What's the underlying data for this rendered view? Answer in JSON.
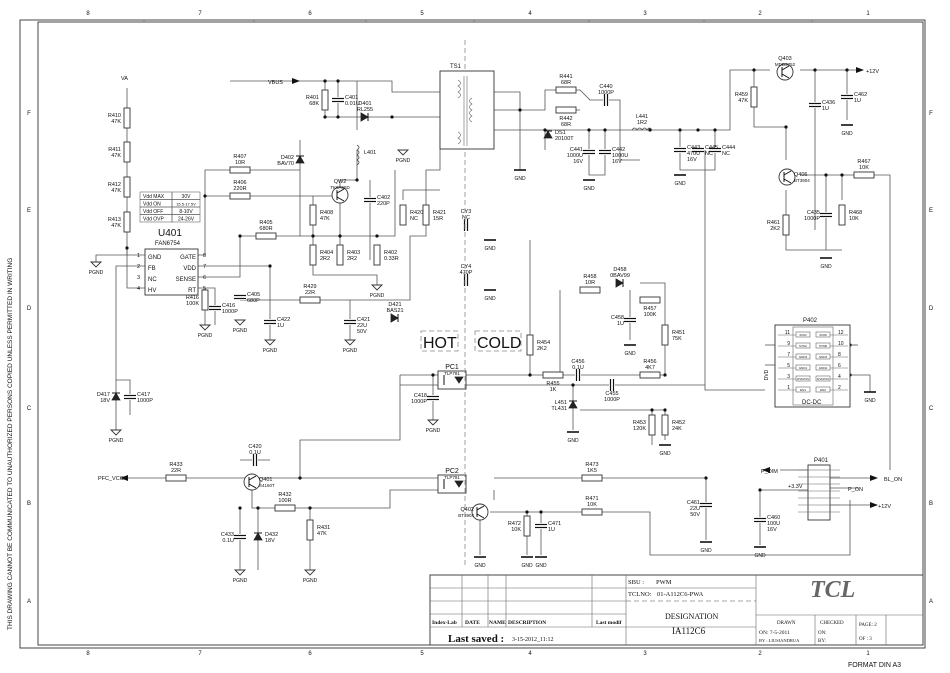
{
  "frame": {
    "columns": [
      "8",
      "7",
      "6",
      "5",
      "4",
      "3",
      "2",
      "1"
    ],
    "rows": [
      "F",
      "E",
      "D",
      "C",
      "B",
      "A"
    ],
    "side_note": "THIS DRAWING CANNOT BE COMMUNICATED TO UNAUTHORIZED PERSONS COPIED UNLESS PERMITTED IN WRITING",
    "format": "FORMAT DIN A3"
  },
  "regions": {
    "hot": "HOT",
    "cold": "COLD"
  },
  "nets": {
    "va": "VA",
    "vbus": "VBUS",
    "v12_top": "+12V",
    "pfc_vcc": "PFC_VCC",
    "p_dim": "P_DIM",
    "bl_on": "BL_ON",
    "p_on": "P_ON",
    "v33": "+3.3V",
    "v12_bottom": "+12V",
    "gnd": "GND",
    "pgnd": "PGND",
    "dvd": "DVD"
  },
  "vdd_table": [
    [
      "Vdd MAX",
      "30V"
    ],
    [
      "Vdd ON",
      "15.5-17.5V"
    ],
    [
      "Vdd OFF",
      "8-10V"
    ],
    [
      "Vdd OVP",
      "24-26V"
    ]
  ],
  "u401": {
    "ref": "U401",
    "part": "FAN6754",
    "pins_left": [
      [
        "1",
        "GND"
      ],
      [
        "2",
        "FB"
      ],
      [
        "3",
        "NC"
      ],
      [
        "4",
        "HV"
      ]
    ],
    "pins_right": [
      [
        "8",
        "GATE"
      ],
      [
        "7",
        "VDD"
      ],
      [
        "6",
        "SENSE"
      ],
      [
        "5",
        "RT"
      ]
    ]
  },
  "ts1": {
    "ref": "TS1"
  },
  "p402": {
    "ref": "P402",
    "footer": "DC-DC",
    "pins": [
      [
        "11",
        "3V3C",
        "3V3D",
        "12"
      ],
      [
        "9",
        "5VSA",
        "5VSB",
        "10"
      ],
      [
        "7",
        "GND3",
        "GND4",
        "8"
      ],
      [
        "5",
        "GND1",
        "GND2",
        "6"
      ],
      [
        "3",
        "DVD/ON",
        "DVD/ON",
        "4"
      ],
      [
        "1",
        "EN1",
        "EN2",
        "2"
      ]
    ]
  },
  "p401": {
    "ref": "P401"
  },
  "components": [
    {
      "ref": "R410",
      "value": "47K"
    },
    {
      "ref": "R411",
      "value": "47K"
    },
    {
      "ref": "R412",
      "value": "47K"
    },
    {
      "ref": "R413",
      "value": "47K"
    },
    {
      "ref": "R401",
      "value": "68K"
    },
    {
      "ref": "C401",
      "value": "0.01U"
    },
    {
      "ref": "D401",
      "value": "RL255"
    },
    {
      "ref": "R407",
      "value": "10R"
    },
    {
      "ref": "R406",
      "value": "220R"
    },
    {
      "ref": "D402",
      "value": "BAV70"
    },
    {
      "ref": "QW2",
      "value": "TK6A65D"
    },
    {
      "ref": "L401",
      "value": ""
    },
    {
      "ref": "C402",
      "value": "220P"
    },
    {
      "ref": "R408",
      "value": "47K"
    },
    {
      "ref": "R405",
      "value": "680R"
    },
    {
      "ref": "R404",
      "value": "2R2"
    },
    {
      "ref": "R403",
      "value": "2R2"
    },
    {
      "ref": "R402",
      "value": "0.33R"
    },
    {
      "ref": "C405",
      "value": "680P"
    },
    {
      "ref": "R416",
      "value": "100K"
    },
    {
      "ref": "C416",
      "value": "1000P"
    },
    {
      "ref": "C422",
      "value": "1U"
    },
    {
      "ref": "R429",
      "value": "22R"
    },
    {
      "ref": "C421",
      "value": "22U 50V"
    },
    {
      "ref": "D421",
      "value": "BAS21"
    },
    {
      "ref": "R420",
      "value": "NC"
    },
    {
      "ref": "R421",
      "value": "15R"
    },
    {
      "ref": "CY3",
      "value": "NC"
    },
    {
      "ref": "CY4",
      "value": "470P"
    },
    {
      "ref": "R441",
      "value": "68R"
    },
    {
      "ref": "R442",
      "value": "68R"
    },
    {
      "ref": "C440",
      "value": "1000P"
    },
    {
      "ref": "DS1",
      "value": "20100T"
    },
    {
      "ref": "C441",
      "value": "1000U 16V"
    },
    {
      "ref": "C442",
      "value": "1000U 16V"
    },
    {
      "ref": "L441",
      "value": "1R2"
    },
    {
      "ref": "C443",
      "value": "470U 16V"
    },
    {
      "ref": "C445",
      "value": "NC"
    },
    {
      "ref": "C444",
      "value": "NC"
    },
    {
      "ref": "Q403",
      "value": "MDD3752"
    },
    {
      "ref": "R459",
      "value": "47K"
    },
    {
      "ref": "C436",
      "value": "1U"
    },
    {
      "ref": "C462",
      "value": "1U"
    },
    {
      "ref": "Q406",
      "value": "BT3904"
    },
    {
      "ref": "R467",
      "value": "10K"
    },
    {
      "ref": "C435",
      "value": "1000P"
    },
    {
      "ref": "R468",
      "value": "10K"
    },
    {
      "ref": "R461",
      "value": "2K2"
    },
    {
      "ref": "R454",
      "value": "2K2"
    },
    {
      "ref": "R458",
      "value": "10R"
    },
    {
      "ref": "D458",
      "value": "0BAV99"
    },
    {
      "ref": "R457",
      "value": "100K"
    },
    {
      "ref": "C458",
      "value": "1U"
    },
    {
      "ref": "R451",
      "value": "75K"
    },
    {
      "ref": "PC1",
      "value": "TLP781"
    },
    {
      "ref": "C418",
      "value": "1000P"
    },
    {
      "ref": "R455",
      "value": "1K"
    },
    {
      "ref": "C456",
      "value": "0.1U"
    },
    {
      "ref": "R456",
      "value": "4K7"
    },
    {
      "ref": "C455",
      "value": "1000P"
    },
    {
      "ref": "L451",
      "value": "TL431"
    },
    {
      "ref": "R453",
      "value": "120K"
    },
    {
      "ref": "R452",
      "value": "24K"
    },
    {
      "ref": "D417",
      "value": "18V"
    },
    {
      "ref": "C417",
      "value": "1000P"
    },
    {
      "ref": "R433",
      "value": "22R"
    },
    {
      "ref": "C420",
      "value": "0.1U"
    },
    {
      "ref": "Q401",
      "value": "S4160T"
    },
    {
      "ref": "R432",
      "value": "100R"
    },
    {
      "ref": "C433",
      "value": "0.1U"
    },
    {
      "ref": "D432",
      "value": "18V"
    },
    {
      "ref": "R431",
      "value": "47K"
    },
    {
      "ref": "PC2",
      "value": "TLP781"
    },
    {
      "ref": "R473",
      "value": "1K5"
    },
    {
      "ref": "C461",
      "value": "22U 50V"
    },
    {
      "ref": "Q402",
      "value": "BT3904"
    },
    {
      "ref": "R472",
      "value": "10K"
    },
    {
      "ref": "C471",
      "value": "1U"
    },
    {
      "ref": "R471",
      "value": "10K"
    },
    {
      "ref": "C460",
      "value": "100U 16V"
    }
  ],
  "title_block": {
    "sbu_label": "SBU :",
    "sbu": "PWM",
    "tclno_label": "TCLNO:",
    "tclno": "01-A112C6-PWA",
    "designation_label": "DESIGNATION",
    "designation": "IA112C6",
    "logo": "TCL",
    "headers": [
      "Index-Lab",
      "DATE",
      "NAME",
      "DESCRIPTION",
      "Last modif"
    ],
    "last_saved_label": "Last saved :",
    "last_saved": "3-15-2012_11:12",
    "drawn_label": "DRAWN",
    "drawn_on": "ON: 7-5-2011",
    "drawn_by": "BY : LIUSIANDRUA",
    "checked_label": "CHECKED",
    "checked_on": "ON:",
    "checked_by": "BY:",
    "page_label": "PAGE: 2",
    "of_label": "OF : 3"
  }
}
